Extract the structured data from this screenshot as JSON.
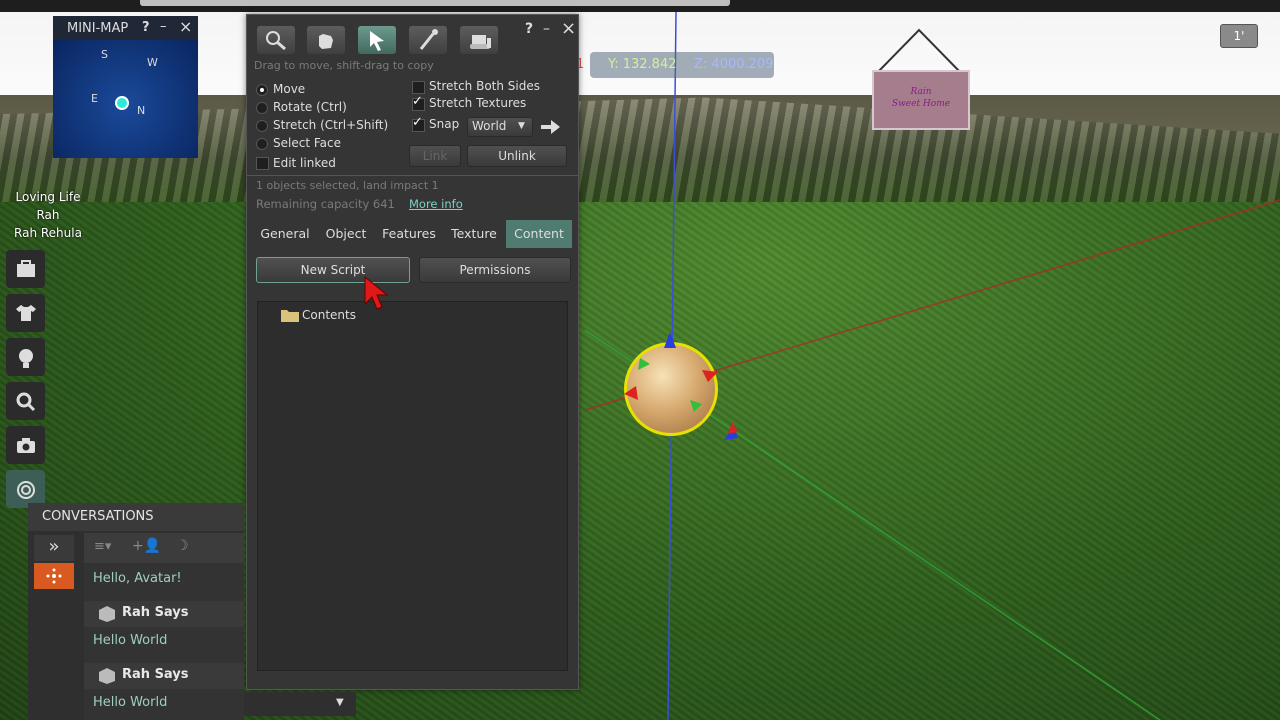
{
  "hud": {
    "y_coord": "Y: 132.842",
    "z_coord": "Z: 4000.209",
    "x_coord_fragment": "1"
  },
  "corner_badge": "1'",
  "minimap": {
    "title": "MINI-MAP",
    "help": "?",
    "minimize": "–",
    "close": "×",
    "directions": {
      "s": "S",
      "w": "W",
      "e": "E",
      "n": "N"
    }
  },
  "avatar": {
    "group": "Loving Life",
    "first_name": "Rah",
    "full_name": "Rah Rehula"
  },
  "build": {
    "help": "?",
    "minimize": "–",
    "close": "×",
    "hint": "Drag to move, shift-drag to copy",
    "modes": [
      "Move",
      "Rotate (Ctrl)",
      "Stretch (Ctrl+Shift)",
      "Select Face"
    ],
    "selected_mode": "Move",
    "edit_linked": "Edit linked",
    "stretch_both_sides": "Stretch Both Sides",
    "stretch_textures": "Stretch Textures",
    "snap": "Snap",
    "snap_value": "World",
    "link": "Link",
    "unlink": "Unlink",
    "selection_info": "1 objects selected, land impact 1",
    "capacity": "Remaining capacity 641",
    "more_info": "More info",
    "tabs": [
      "General",
      "Object",
      "Features",
      "Texture",
      "Content"
    ],
    "active_tab": "Content",
    "new_script": "New Script",
    "permissions": "Permissions",
    "folder": "Contents"
  },
  "conversations": {
    "title": "CONVERSATIONS",
    "expand": "»",
    "messages": [
      {
        "text": "Hello, Avatar!"
      },
      {
        "speaker": "Rah Says",
        "text": "Hello World"
      },
      {
        "speaker": "Rah Says",
        "text": "Hello World"
      }
    ]
  },
  "sign_text": [
    "Rain",
    "Sweet Home"
  ]
}
